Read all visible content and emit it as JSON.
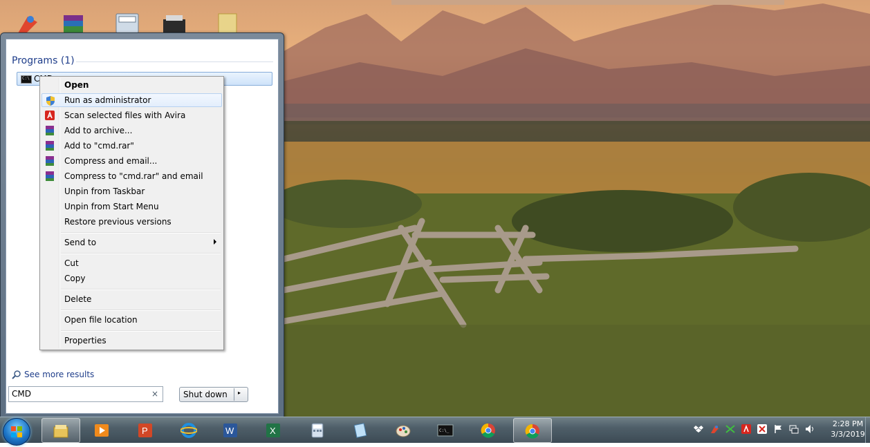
{
  "start_menu": {
    "programs_header": "Programs (1)",
    "program_item": {
      "label": "CMD",
      "icon": "cmd-icon"
    },
    "see_more_results": "See more results",
    "search": {
      "value": "CMD",
      "clear_icon": "×"
    },
    "shutdown_label": "Shut down",
    "shutdown_arrow": "▸"
  },
  "context_menu": {
    "items": [
      {
        "label": "Open"
      },
      {
        "label": "Run as administrator",
        "icon": "uac-shield-icon"
      },
      {
        "label": "Scan selected files with Avira",
        "icon": "avira-icon"
      },
      {
        "label": "Add to archive...",
        "icon": "winrar-icon"
      },
      {
        "label": "Add to \"cmd.rar\"",
        "icon": "winrar-icon"
      },
      {
        "label": "Compress and email...",
        "icon": "winrar-icon"
      },
      {
        "label": "Compress to \"cmd.rar\" and email",
        "icon": "winrar-icon"
      },
      {
        "label": "Unpin from Taskbar"
      },
      {
        "label": "Unpin from Start Menu"
      },
      {
        "label": "Restore previous versions"
      },
      {
        "label": "Send to"
      },
      {
        "label": "Cut"
      },
      {
        "label": "Copy"
      },
      {
        "label": "Delete"
      },
      {
        "label": "Open file location"
      },
      {
        "label": "Properties"
      }
    ]
  },
  "taskbar": {
    "pinned": [
      "windows-explorer-icon",
      "media-player-icon",
      "powerpoint-icon",
      "internet-explorer-icon",
      "word-icon",
      "excel-icon",
      "calculator-icon",
      "notepad-icon",
      "paint-icon",
      "command-prompt-icon",
      "chrome-icon",
      "chrome-active-icon"
    ],
    "clock": {
      "time": "2:28 PM",
      "date": "3/3/2019"
    }
  },
  "colors": {
    "accent": "#1e3d8a",
    "taskbar": "#4f5f69"
  }
}
